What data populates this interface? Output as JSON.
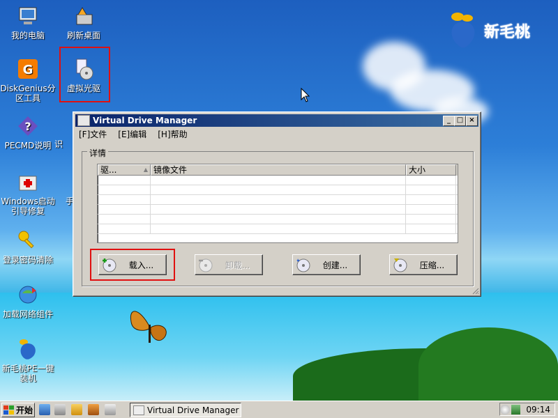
{
  "brand": {
    "text": "新毛桃",
    "color": "#2a68c9"
  },
  "desktop_icons": [
    {
      "label": "我的电脑",
      "icon": "computer-icon"
    },
    {
      "label": "刷新桌面",
      "icon": "refresh-desktop-icon"
    },
    {
      "label": "DiskGenius分区工具",
      "icon": "diskgenius-icon"
    },
    {
      "label": "虚拟光驱",
      "icon": "virtual-drive-icon"
    },
    {
      "label": "PECMD说明",
      "icon": "help-icon"
    },
    {
      "label": "识",
      "icon": "partial-icon"
    },
    {
      "label": "Windows启动引导修复",
      "icon": "first-aid-icon"
    },
    {
      "label": "手",
      "icon": "partial-icon"
    },
    {
      "label": "登录密码清除",
      "icon": "key-icon"
    },
    {
      "label": "加载网络组件",
      "icon": "network-icon"
    },
    {
      "label": "新毛桃PE一键装机",
      "icon": "peach-icon"
    }
  ],
  "window": {
    "title": "Virtual Drive Manager",
    "controls": {
      "minimize": "_",
      "maximize": "□",
      "close": "×"
    },
    "menu": [
      {
        "label": "[F]文件"
      },
      {
        "label": "[E]编辑"
      },
      {
        "label": "[H]帮助"
      }
    ],
    "group_title": "详情",
    "columns": [
      {
        "label": "驱..."
      },
      {
        "label": "镜像文件"
      },
      {
        "label": "大小"
      }
    ],
    "rows": [],
    "buttons": [
      {
        "label": "载入...",
        "enabled": true
      },
      {
        "label": "卸载...",
        "enabled": false
      },
      {
        "label": "创建...",
        "enabled": true
      },
      {
        "label": "压缩...",
        "enabled": true
      }
    ]
  },
  "taskbar": {
    "start_label": "开始",
    "task_item": "Virtual Drive Manager",
    "clock": "09:14"
  },
  "highlight_color": "#e01010"
}
